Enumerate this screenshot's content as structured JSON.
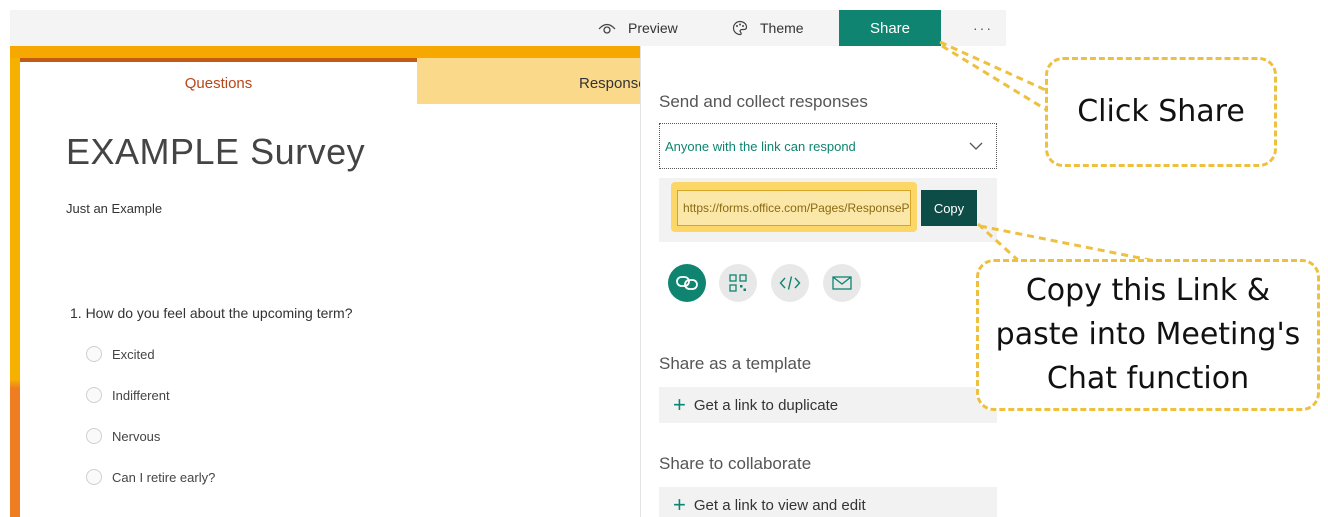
{
  "topbar": {
    "preview_label": "Preview",
    "theme_label": "Theme",
    "share_label": "Share",
    "more_label": "···"
  },
  "tabs": {
    "questions": "Questions",
    "responses": "Responses"
  },
  "form": {
    "title": "EXAMPLE Survey",
    "subtitle": "Just an Example",
    "question": "1. How do you feel about the upcoming term?",
    "options": [
      "Excited",
      "Indifferent",
      "Nervous",
      "Can I retire early?"
    ]
  },
  "share_panel": {
    "heading": "Send and collect responses",
    "access_value": "Anyone with the link can respond",
    "link_value": "https://forms.office.com/Pages/ResponsePage.aspx",
    "copy_label": "Copy",
    "share_methods": [
      "link-icon",
      "qr-code-icon",
      "embed-code-icon",
      "email-icon"
    ],
    "template_heading": "Share as a template",
    "template_action": "Get a link to duplicate",
    "collaborate_heading": "Share to collaborate",
    "collaborate_action": "Get a link to view and edit"
  },
  "callouts": {
    "share": "Click Share",
    "copy_line1": "Copy this Link &",
    "copy_line2": "paste into Meeting's",
    "copy_line3": "Chat function"
  },
  "colors": {
    "brand": "#0f8571",
    "copy_button": "#0e4d47",
    "accent_orange": "#f6a800",
    "callout_border": "#eec03f"
  }
}
